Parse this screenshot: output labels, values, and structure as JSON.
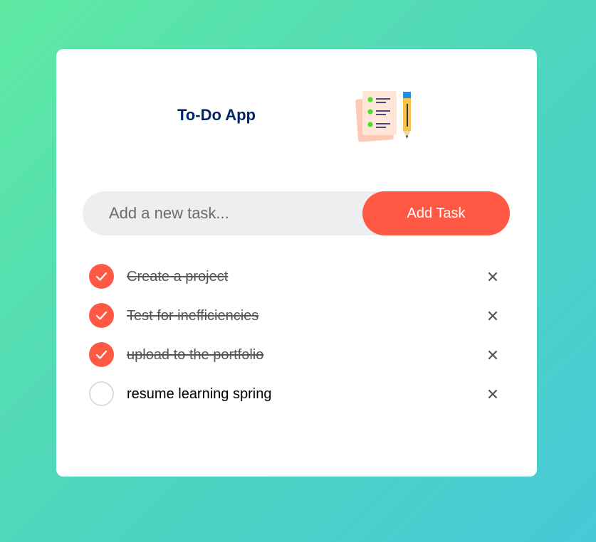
{
  "app": {
    "title": "To-Do App",
    "icon": "checklist-with-pencil-icon"
  },
  "input": {
    "placeholder": "Add a new task...",
    "value": ""
  },
  "add_button": {
    "label": "Add Task"
  },
  "colors": {
    "accent": "#ff5945",
    "title": "#002765",
    "background_start": "#5eeaa2",
    "background_end": "#47c9d8"
  },
  "tasks": [
    {
      "text": "Create a project",
      "completed": true
    },
    {
      "text": "Test for inefficiencies",
      "completed": true
    },
    {
      "text": "upload to the portfolio",
      "completed": true
    },
    {
      "text": "resume learning spring",
      "completed": false
    }
  ],
  "delete_icon": "close-icon"
}
